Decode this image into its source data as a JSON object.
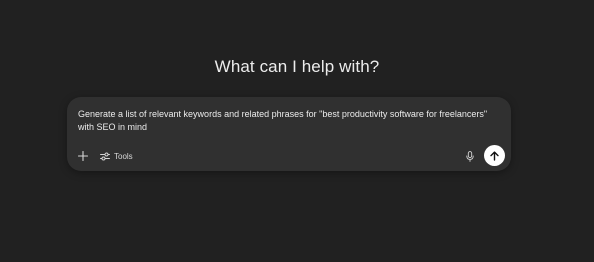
{
  "heading": "What can I help with?",
  "composer": {
    "prompt_text": "Generate a list of relevant keywords and related phrases for \"best productivity software for freelancers\" with SEO in mind",
    "tools_label": "Tools"
  },
  "icons": {
    "plus": "plus-icon",
    "tools": "sliders-icon",
    "mic": "microphone-icon",
    "send": "arrow-up-icon"
  },
  "colors": {
    "background": "#212121",
    "composer": "#303030",
    "text": "#ececec",
    "send_button": "#ffffff"
  }
}
